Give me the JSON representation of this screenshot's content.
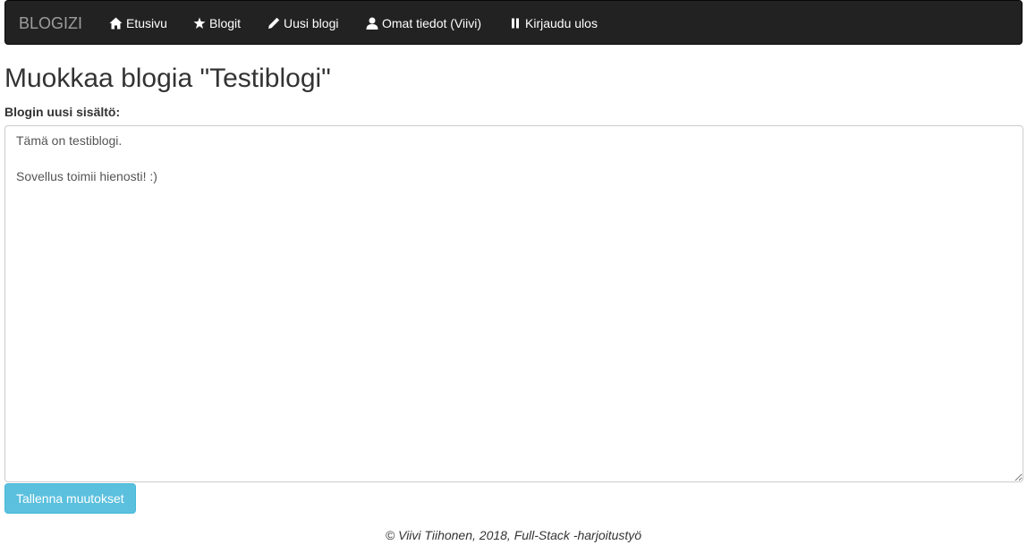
{
  "navbar": {
    "brand": "BLOGIZI",
    "items": [
      {
        "label": "Etusivu",
        "icon": "home-icon"
      },
      {
        "label": "Blogit",
        "icon": "star-icon"
      },
      {
        "label": "Uusi blogi",
        "icon": "pencil-icon"
      },
      {
        "label": "Omat tiedot (Viivi)",
        "icon": "user-icon"
      },
      {
        "label": "Kirjaudu ulos",
        "icon": "pause-icon"
      }
    ]
  },
  "page": {
    "title": "Muokkaa blogia \"Testiblogi\""
  },
  "form": {
    "content_label": "Blogin uusi sisältö:",
    "content_value": "Tämä on testiblogi.\n\nSovellus toimii hienosti! :)",
    "save_label": "Tallenna muutokset"
  },
  "footer": {
    "text": "© Viivi Tiihonen, 2018, Full-Stack -harjoitustyö"
  },
  "colors": {
    "navbar_bg": "#222222",
    "brand_text": "#9d9d9d",
    "save_button_bg": "#5bc0de"
  }
}
